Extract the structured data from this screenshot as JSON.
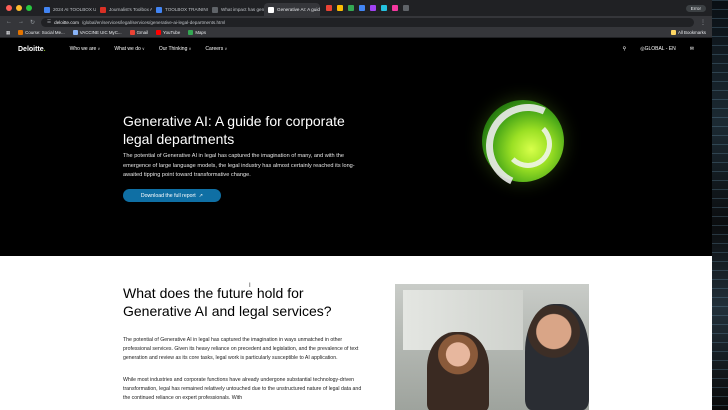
{
  "browser": {
    "tabs": [
      {
        "label": "2024 AI TOOLBOX UPDATE",
        "color": "#4285f4",
        "active": false
      },
      {
        "label": "Journalist's Toolbox AI | Loo",
        "color": "#d93025",
        "active": false
      },
      {
        "label": "TOOLBOX TRAINING SUMM",
        "color": "#4285f4",
        "active": false
      },
      {
        "label": "What impact has generative",
        "color": "#5f6368",
        "active": false
      },
      {
        "label": "Generative AI: A guide for co",
        "color": "#ffffff",
        "active": true
      }
    ],
    "error_label": "Error",
    "url_host": "deloitte.com",
    "url_path": "/global/en/services/legal/services/generative-ai-legal-departments.html",
    "bookmarks": [
      {
        "label": "Course: Social Me...",
        "color": "#e37400"
      },
      {
        "label": "VACCINE UIC MyC...",
        "color": "#8ab4f8"
      },
      {
        "label": "Gmail",
        "color": "#ea4335"
      },
      {
        "label": "YouTube",
        "color": "#ff0000"
      },
      {
        "label": "Maps",
        "color": "#34a853"
      }
    ],
    "all_bookmarks": "All Bookmarks"
  },
  "site": {
    "logo": "Deloitte",
    "logo_dot": ".",
    "nav": [
      "Who we are",
      "What we do",
      "Our Thinking",
      "Careers"
    ],
    "locale": "GLOBAL - EN"
  },
  "hero": {
    "title": "Generative AI: A guide for corporate legal departments",
    "body": "The potential of Generative AI in legal has captured the imagination of many, and with the emergence of large language models, the legal industry has almost certainly reached its long-awaited tipping point toward transformative change.",
    "cta": "Download the full report"
  },
  "content": {
    "heading": "What does the future hold for Generative AI and legal services?",
    "p1": "The potential of Generative AI in legal has captured the imagination in ways unmatched in other professional services. Given its heavy reliance on precedent and legislation, and the prevalence of text generation and review as its core tasks, legal work is particularly susceptible to AI application.",
    "p2": "While most industries and corporate functions have already undergone substantial technology-driven transformation, legal has remained relatively untouched due to the unstructured nature of legal data and the continued reliance on expert professionals. With"
  },
  "colors": {
    "accent_green": "#86bc25",
    "cta_blue": "#0f6fa4"
  }
}
